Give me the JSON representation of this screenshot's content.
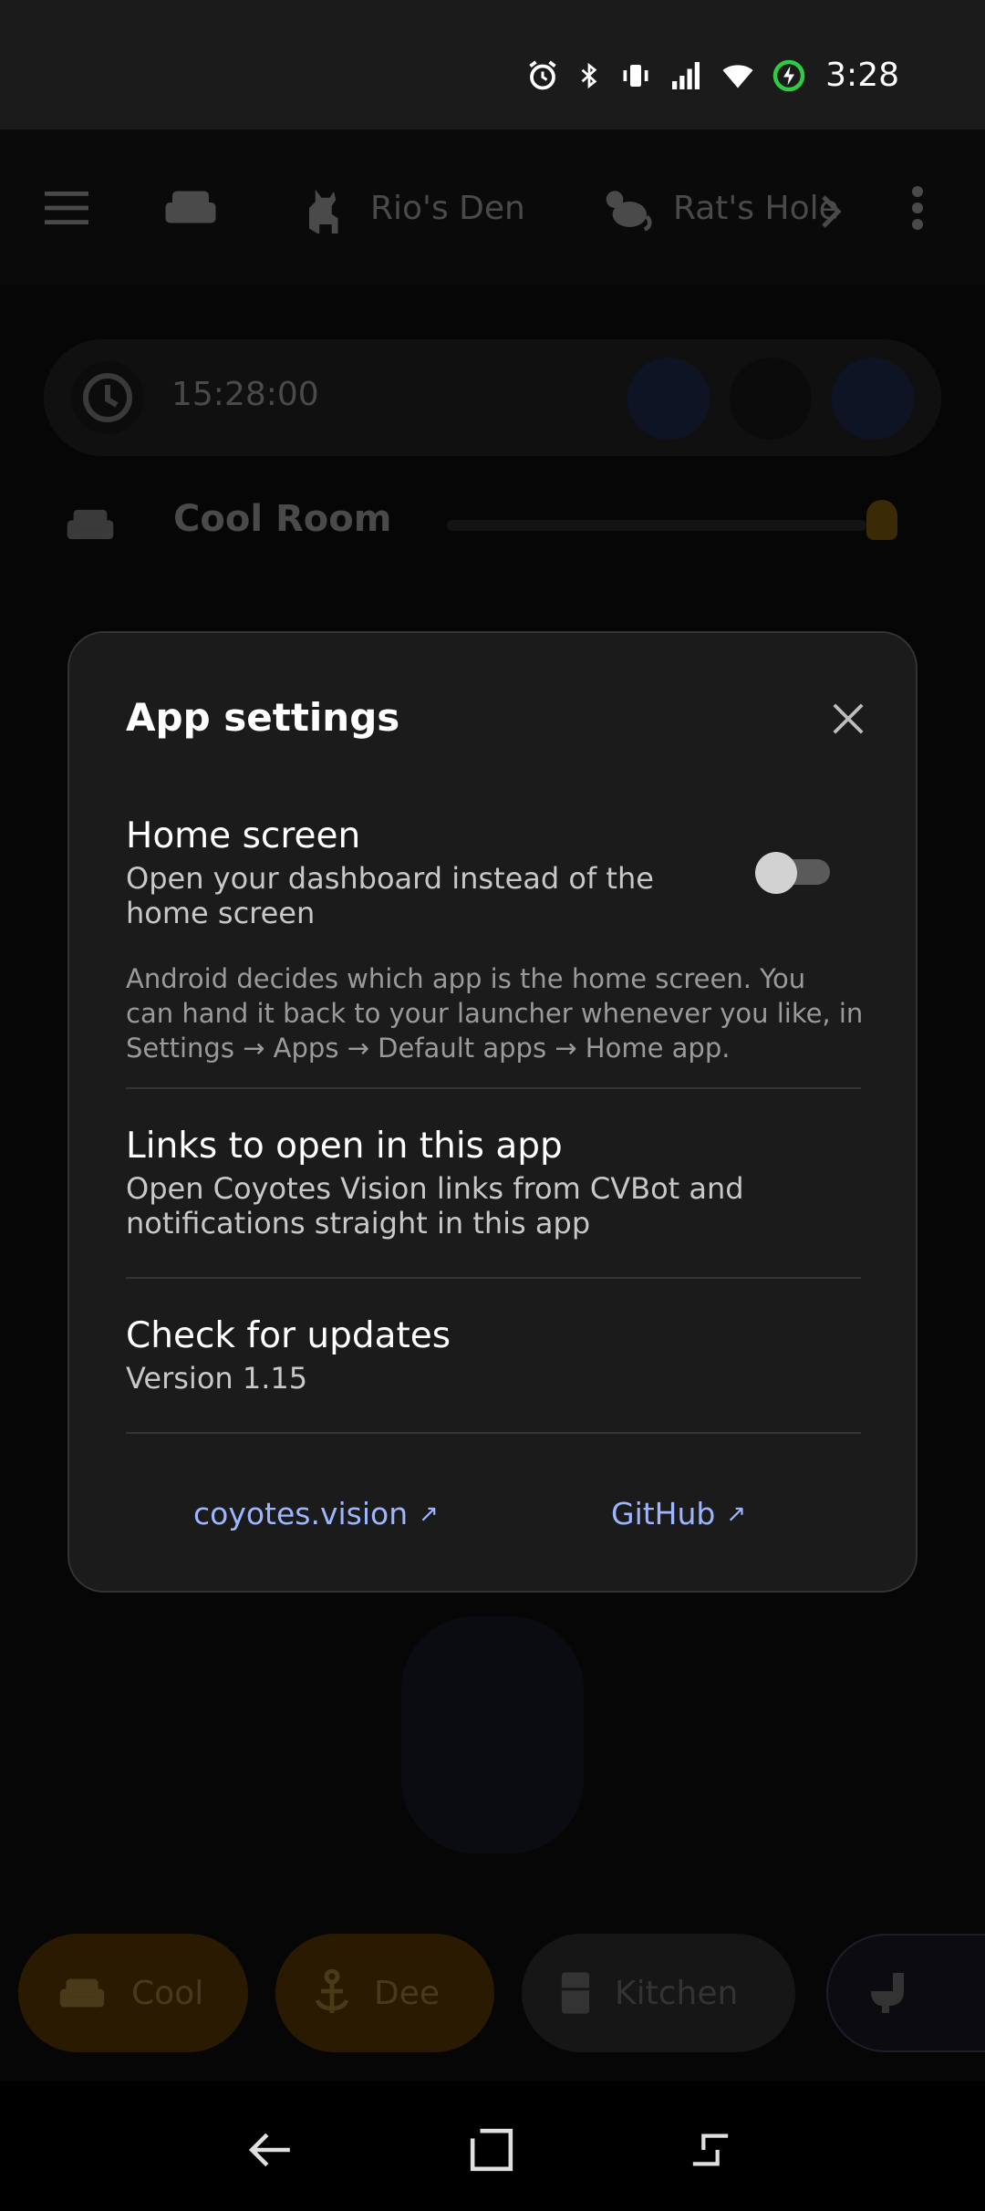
{
  "status_bar": {
    "time": "3:28",
    "icons": [
      "alarm-icon",
      "bluetooth-icon",
      "vibrate-icon",
      "signal-icon",
      "wifi-icon",
      "battery-charging-icon"
    ]
  },
  "app": {
    "toolbar": {
      "menu_icon": "menu-icon",
      "sofa_icon": "sofa-icon",
      "rooms": [
        {
          "label": "Rio's Den",
          "icon": "dog-icon"
        },
        {
          "label": "Rat's Hole",
          "icon": "rat-icon"
        }
      ]
    },
    "timebar": {
      "time": "15:28:00"
    },
    "room_row": {
      "name": "Cool Room"
    },
    "bottom_tabs": [
      {
        "label": "Cool",
        "icon": "sofa-icon"
      },
      {
        "label": "Dee",
        "icon": "anchor-icon"
      },
      {
        "label": "Kitchen",
        "icon": "fridge-icon"
      }
    ]
  },
  "modal": {
    "title": "App settings",
    "home_screen": {
      "title": "Home screen",
      "subtitle_line1": "Open your dashboard instead of the",
      "subtitle_line2": "home screen",
      "note_line1": "Android decides which app is the home screen. You",
      "note_line2": "can hand it back to your launcher whenever you like, in",
      "note_line3": "Settings → Apps → Default apps → Home app.",
      "toggle_on": false
    },
    "links": {
      "title": "Links to open in this app",
      "subtitle_line1": "Open Coyotes Vision links from CVBot and",
      "subtitle_line2": "notifications straight in this app"
    },
    "updates": {
      "title": "Check for updates",
      "version": "Version 1.15"
    },
    "footer": {
      "link1": "coyotes.vision",
      "link2": "GitHub",
      "arrow": "↗"
    }
  },
  "colors": {
    "accent_link": "#9db6ff",
    "modal_bg": "#1b1b1b",
    "battery_charge": "#2ecc40"
  }
}
